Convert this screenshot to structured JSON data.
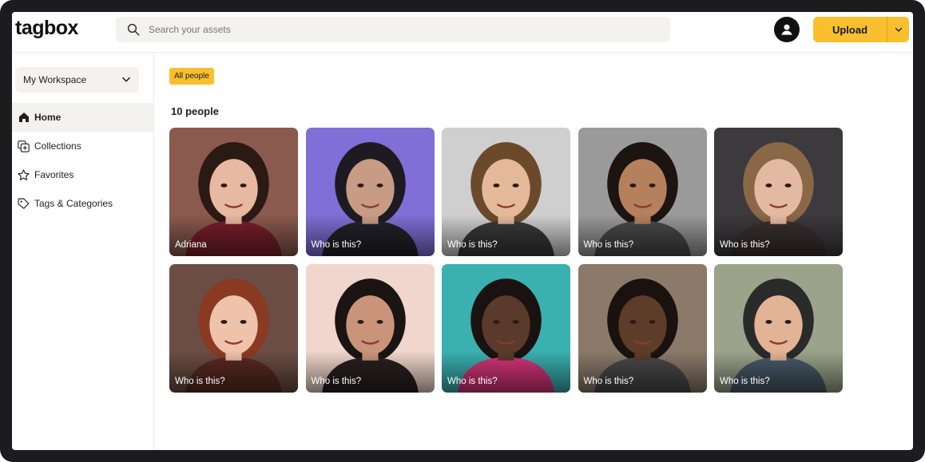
{
  "header": {
    "logo": "tagbox",
    "search_placeholder": "Search your assets",
    "upload_label": "Upload"
  },
  "sidebar": {
    "workspace": "My Workspace",
    "items": [
      {
        "label": "Home",
        "icon": "home-icon",
        "active": true
      },
      {
        "label": "Collections",
        "icon": "collections-icon",
        "active": false
      },
      {
        "label": "Favorites",
        "icon": "star-icon",
        "active": false
      },
      {
        "label": "Tags & Categories",
        "icon": "tag-icon",
        "active": false
      }
    ]
  },
  "main": {
    "filter_chip": "All people",
    "count_label": "10 people",
    "people": [
      {
        "label": "Adriana",
        "bg": "#8a5a4e",
        "skin": "#e6b9a0",
        "hair": "#2b1a14",
        "shirt": "#7a1f2a"
      },
      {
        "label": "Who is this?",
        "bg": "#7f6fd6",
        "skin": "#c89b84",
        "hair": "#1e1a22",
        "shirt": "#222229"
      },
      {
        "label": "Who is this?",
        "bg": "#cfcfcf",
        "skin": "#e3b99a",
        "hair": "#6b4a2c",
        "shirt": "#3a3a3a"
      },
      {
        "label": "Who is this?",
        "bg": "#9a9a9a",
        "skin": "#b5805c",
        "hair": "#1b1410",
        "shirt": "#4a4a4a"
      },
      {
        "label": "Who is this?",
        "bg": "#3c3a3d",
        "skin": "#e4b9a1",
        "hair": "#8a6746",
        "shirt": "#3a3030"
      },
      {
        "label": "Who is this?",
        "bg": "#6b4d43",
        "skin": "#efc2ab",
        "hair": "#8a3a22",
        "shirt": "#5a2a22"
      },
      {
        "label": "Who is this?",
        "bg": "#f0d6cc",
        "skin": "#c99479",
        "hair": "#1a1412",
        "shirt": "#2a2020"
      },
      {
        "label": "Who is this?",
        "bg": "#3ab0b0",
        "skin": "#5a3a2a",
        "hair": "#1a1210",
        "shirt": "#d8347a"
      },
      {
        "label": "Who is this?",
        "bg": "#8b7a6a",
        "skin": "#5e3c2a",
        "hair": "#1a120e",
        "shirt": "#4a4a4a"
      },
      {
        "label": "Who is this?",
        "bg": "#9ba38b",
        "skin": "#e2b395",
        "hair": "#2a2a2a",
        "shirt": "#4a5a6a"
      }
    ]
  },
  "colors": {
    "accent": "#f9bf2e",
    "frame": "#1c1c1e",
    "panel": "#f3f2ef"
  }
}
